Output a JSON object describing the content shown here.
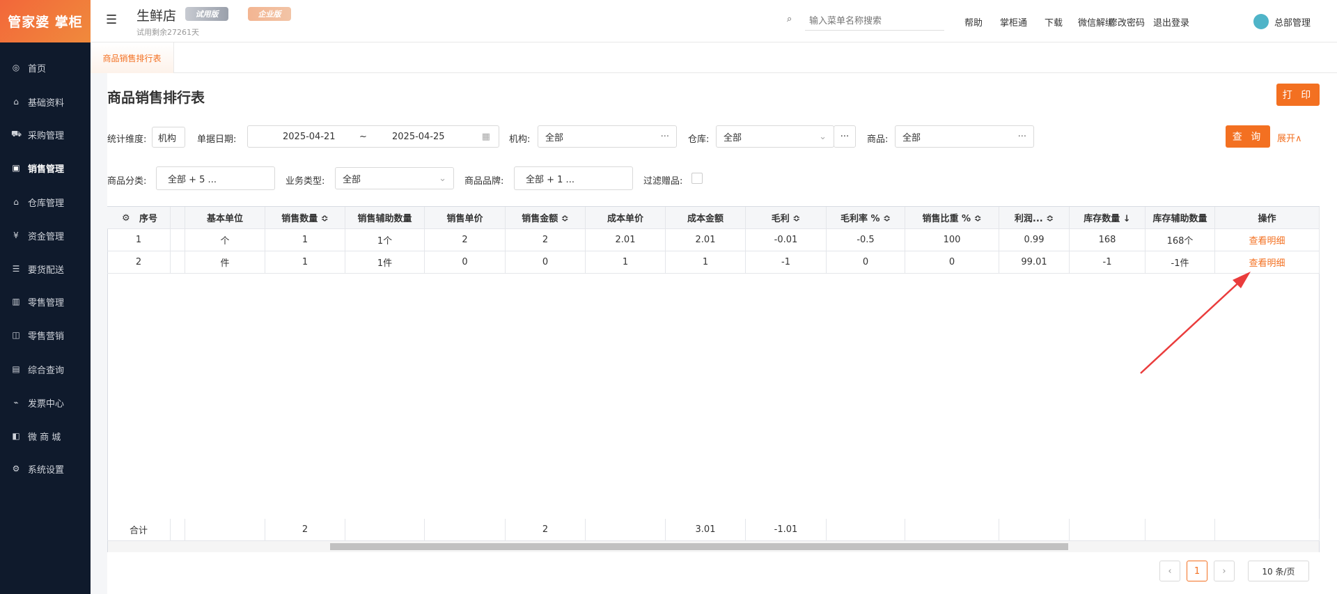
{
  "sidebar": {
    "logo": "管家婆 掌柜",
    "items": [
      {
        "label": "首页",
        "icon": "globe-icon",
        "g": "◎"
      },
      {
        "label": "基础资料",
        "icon": "home-icon",
        "g": "⌂"
      },
      {
        "label": "采购管理",
        "icon": "cart-icon",
        "g": "⛟"
      },
      {
        "label": "销售管理",
        "icon": "calendar-icon",
        "g": "▣"
      },
      {
        "label": "仓库管理",
        "icon": "warehouse-icon",
        "g": "⌂"
      },
      {
        "label": "资金管理",
        "icon": "money-icon",
        "g": "¥"
      },
      {
        "label": "要货配送",
        "icon": "list-icon",
        "g": "☰"
      },
      {
        "label": "零售管理",
        "icon": "chart-icon",
        "g": "▥"
      },
      {
        "label": "零售营销",
        "icon": "gift-icon",
        "g": "◫"
      },
      {
        "label": "综合查询",
        "icon": "bar-chart-icon",
        "g": "▤"
      },
      {
        "label": "发票中心",
        "icon": "trend-icon",
        "g": "⌁"
      },
      {
        "label": "微 商 城",
        "icon": "bag-icon",
        "g": "◧"
      },
      {
        "label": "系统设置",
        "icon": "gear-icon",
        "g": "⚙"
      }
    ]
  },
  "header": {
    "store": "生鲜店",
    "trial_badge": "试用版",
    "edition_badge": "企业版",
    "trial_left": "试用剩余27261天",
    "search_placeholder": "输入菜单名称搜索",
    "links": [
      "帮助",
      "掌柜通",
      "下载",
      "微信解绑",
      "修改密码",
      "退出登录"
    ],
    "user": "总部管理"
  },
  "tab": "商品销售排行表",
  "page": {
    "title": "商品销售排行表",
    "print": "打 印",
    "query": "查 询",
    "expand": "展开∧"
  },
  "filters": {
    "dim_label": "统计维度:",
    "dim_value": "机构",
    "date_label": "单据日期:",
    "date_from": "2025-04-21",
    "date_sep": "~",
    "date_to": "2025-04-25",
    "org_label": "机构:",
    "org_value": "全部",
    "wh_label": "仓库:",
    "wh_value": "全部",
    "goods_label": "商品:",
    "goods_value": "全部",
    "cat_label": "商品分类:",
    "cat_value": "全部    + 5 ...",
    "biz_label": "业务类型:",
    "biz_value": "全部",
    "brand_label": "商品品牌:",
    "brand_value": "全部    + 1 ...",
    "gift_label": "过滤赠品:"
  },
  "table": {
    "columns": [
      "序号",
      "",
      "基本单位",
      "销售数量 ≎",
      "销售辅助数量",
      "销售单价",
      "销售金额 ≎",
      "成本单价",
      "成本金额",
      "毛利 ≎",
      "毛利率 % ≎",
      "销售比重 % ≎",
      "利润...  ≎",
      "库存数量 ↓",
      "库存辅助数量",
      "操作"
    ],
    "rows": [
      [
        "1",
        "",
        "个",
        "1",
        "1个",
        "2",
        "2",
        "2.01",
        "2.01",
        "-0.01",
        "-0.5",
        "100",
        "0.99",
        "168",
        "168个",
        "查看明细"
      ],
      [
        "2",
        "",
        "件",
        "1",
        "1件",
        "0",
        "0",
        "1",
        "1",
        "-1",
        "0",
        "0",
        "99.01",
        "-1",
        "-1件",
        "查看明细"
      ]
    ],
    "totals": [
      "合计",
      "",
      "",
      "2",
      "",
      "",
      "2",
      "",
      "3.01",
      "-1.01",
      "",
      "",
      "",
      "",
      "",
      ""
    ]
  },
  "pagination": {
    "current": "1",
    "page_size": "10 条/页"
  }
}
